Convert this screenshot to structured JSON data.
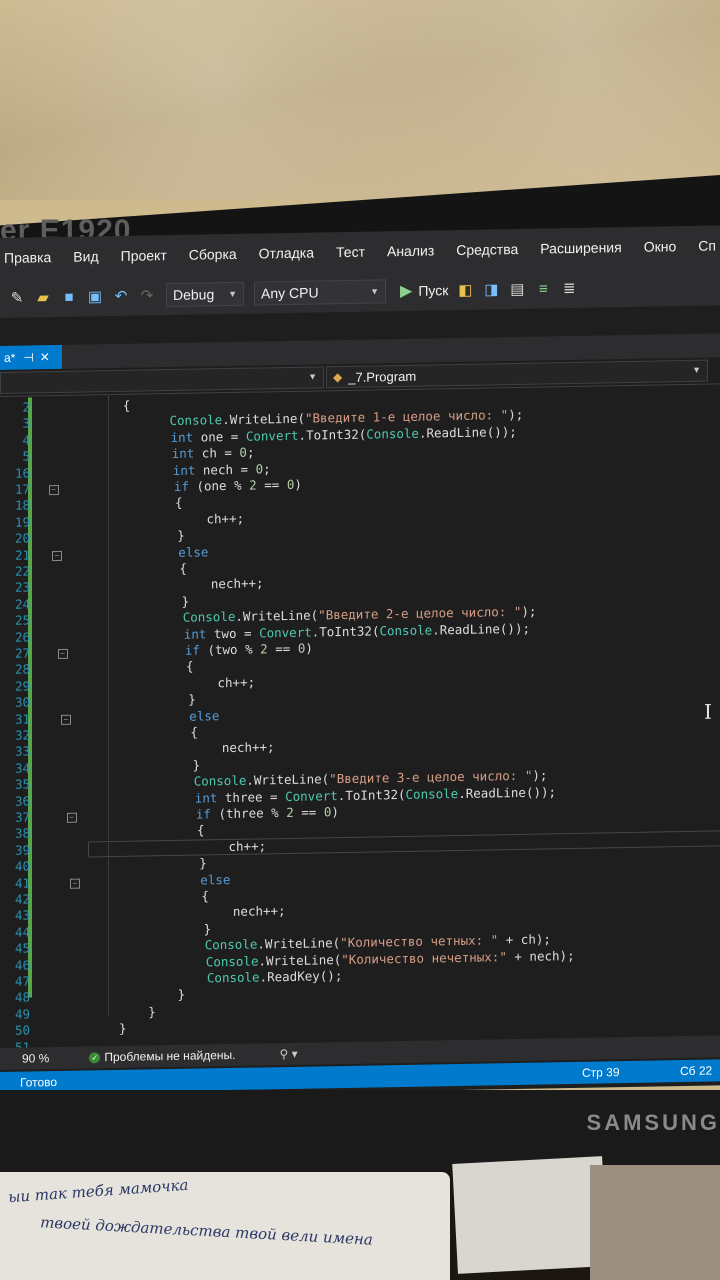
{
  "monitor": {
    "model_label": "er E1920",
    "brand": "SAMSUNG"
  },
  "menu": [
    "Правка",
    "Вид",
    "Проект",
    "Сборка",
    "Отладка",
    "Тест",
    "Анализ",
    "Средства",
    "Расширения",
    "Окно",
    "Сп"
  ],
  "toolbar": {
    "configuration": "Debug",
    "platform": "Any CPU",
    "run_label": "Пуск"
  },
  "tab": {
    "label": "a*",
    "pin_icon": "pin-icon",
    "close_icon": "close-icon"
  },
  "navigation": {
    "member": "_7.Program"
  },
  "code_lines": [
    {
      "n": "2",
      "indent": 8,
      "text": "{"
    },
    {
      "n": "3",
      "indent": 14,
      "text": "Console.WriteLine(\"Введите 1-е целое число: \");"
    },
    {
      "n": "4",
      "indent": 14,
      "text": "int one = Convert.ToInt32(Console.ReadLine());"
    },
    {
      "n": "5",
      "indent": 14,
      "text": "int ch = 0;"
    },
    {
      "n": "16",
      "indent": 14,
      "text": "int nech = 0;"
    },
    {
      "n": "17",
      "indent": 14,
      "text": "if (one % 2 == 0)"
    },
    {
      "n": "18",
      "indent": 14,
      "text": "{"
    },
    {
      "n": "19",
      "indent": 18,
      "text": "ch++;"
    },
    {
      "n": "20",
      "indent": 14,
      "text": "}"
    },
    {
      "n": "21",
      "indent": 14,
      "text": "else"
    },
    {
      "n": "22",
      "indent": 14,
      "text": "{"
    },
    {
      "n": "23",
      "indent": 18,
      "text": "nech++;"
    },
    {
      "n": "24",
      "indent": 14,
      "text": "}"
    },
    {
      "n": "25",
      "indent": 14,
      "text": "Console.WriteLine(\"Введите 2-е целое число: \");"
    },
    {
      "n": "26",
      "indent": 14,
      "text": "int two = Convert.ToInt32(Console.ReadLine());"
    },
    {
      "n": "27",
      "indent": 14,
      "text": "if (two % 2 == 0)"
    },
    {
      "n": "28",
      "indent": 14,
      "text": "{"
    },
    {
      "n": "29",
      "indent": 18,
      "text": "ch++;"
    },
    {
      "n": "30",
      "indent": 14,
      "text": "}"
    },
    {
      "n": "31",
      "indent": 14,
      "text": "else"
    },
    {
      "n": "32",
      "indent": 14,
      "text": "{"
    },
    {
      "n": "33",
      "indent": 18,
      "text": "nech++;"
    },
    {
      "n": "34",
      "indent": 14,
      "text": "}"
    },
    {
      "n": "35",
      "indent": 14,
      "text": "Console.WriteLine(\"Введите 3-е целое число: \");"
    },
    {
      "n": "36",
      "indent": 14,
      "text": "int three = Convert.ToInt32(Console.ReadLine());"
    },
    {
      "n": "37",
      "indent": 14,
      "text": "if (three % 2 == 0)"
    },
    {
      "n": "38",
      "indent": 14,
      "text": "{"
    },
    {
      "n": "39",
      "indent": 18,
      "text": "ch++;"
    },
    {
      "n": "40",
      "indent": 14,
      "text": "}"
    },
    {
      "n": "41",
      "indent": 14,
      "text": "else"
    },
    {
      "n": "42",
      "indent": 14,
      "text": "{"
    },
    {
      "n": "43",
      "indent": 18,
      "text": "nech++;"
    },
    {
      "n": "44",
      "indent": 14,
      "text": "}"
    },
    {
      "n": "45",
      "indent": 14,
      "text": "Console.WriteLine(\"Количество четных: \" + ch);"
    },
    {
      "n": "46",
      "indent": 14,
      "text": "Console.WriteLine(\"Количество нечетных:\" + nech);"
    },
    {
      "n": "47",
      "indent": 14,
      "text": "Console.ReadKey();"
    },
    {
      "n": "48",
      "indent": 10,
      "text": "}"
    },
    {
      "n": "49",
      "indent": 6,
      "text": "}"
    },
    {
      "n": "50",
      "indent": 2,
      "text": "}"
    },
    {
      "n": "51",
      "indent": 0,
      "text": ""
    }
  ],
  "status": {
    "zoom": "90 %",
    "issues": "Проблемы не найдены.",
    "ready": "Готово",
    "line": "Стр 39",
    "col": "Сб 22"
  },
  "note_text": [
    "ыи так тебя мамочка",
    "твоей дождательства твой вели имена"
  ],
  "colors": {
    "keyword": "#569cd6",
    "class": "#4ec9b0",
    "string": "#d69d85",
    "number": "#b5cea8",
    "accent": "#007acc"
  }
}
